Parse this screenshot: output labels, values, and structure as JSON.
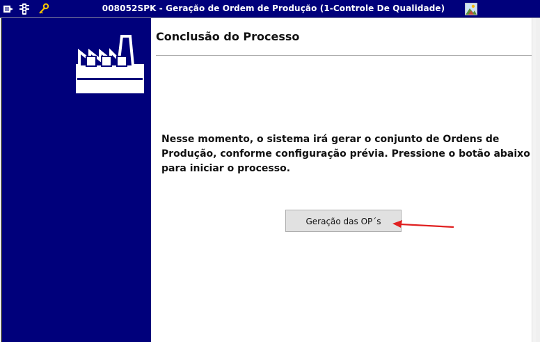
{
  "window": {
    "title": "008052SPK - Geração de Ordem de Produção (1-Controle De Qualidade)"
  },
  "icons": {
    "toolbar": [
      "list-icon",
      "traffic-light-icon",
      "key-icon"
    ],
    "titlebar_right": "image-icon",
    "sidebar": "factory-icon"
  },
  "main": {
    "heading": "Conclusão do Processo",
    "message": "Nesse momento, o sistema irá gerar o conjunto de Ordens de Produção, conforme configuração prévia. Pressione o botão abaixo para iniciar o processo.",
    "generate_button_label": "Geração das OP´s"
  },
  "colors": {
    "titlebar": "#00007b",
    "sidebar": "#00007b",
    "arrow": "#e02020",
    "button": "#e1e1e1"
  }
}
